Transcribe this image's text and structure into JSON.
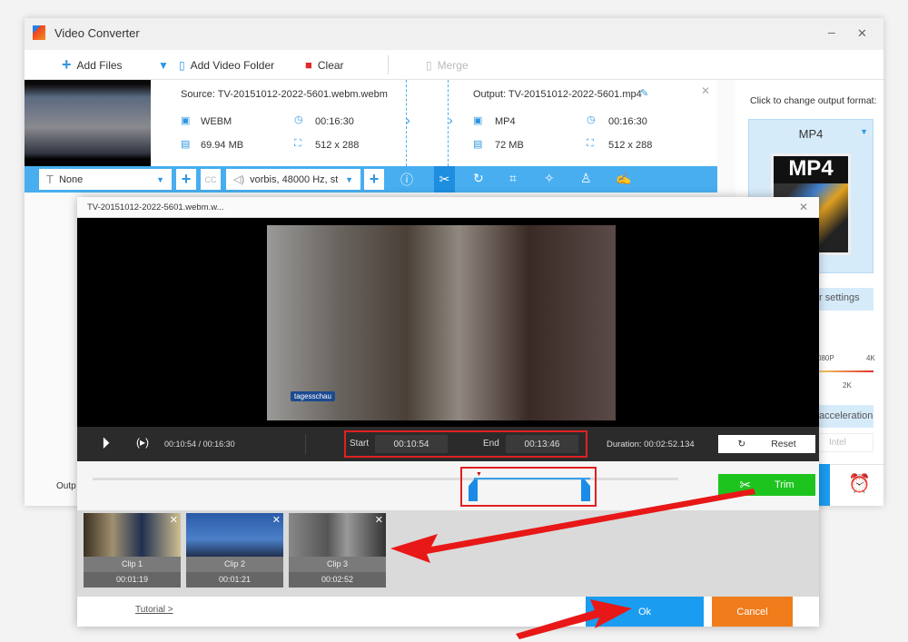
{
  "app": {
    "title": "Video Converter",
    "minimize": "–",
    "close": "✕"
  },
  "toolbar": {
    "add_files": "Add Files",
    "add_folder": "Add Video Folder",
    "clear": "Clear",
    "merge": "Merge"
  },
  "file": {
    "source": "Source: TV-20151012-2022-5601.webm.webm",
    "src_format": "WEBM",
    "src_duration": "00:16:30",
    "src_size": "69.94 MB",
    "src_res": "512 x 288",
    "output": "Output: TV-20151012-2022-5601.mp4",
    "out_format": "MP4",
    "out_duration": "00:16:30",
    "out_size": "72 MB",
    "out_res": "512 x 288"
  },
  "edit_bar": {
    "subtitle": "None",
    "audio": "vorbis, 48000 Hz, st"
  },
  "right_panel": {
    "hint": "Click to change output format:",
    "format": "MP4",
    "format_icon": "MP4",
    "settings": "r settings",
    "q1080": "080P",
    "q4k": "4K",
    "q2k": "2K",
    "accel": "acceleration",
    "intel": "Intel"
  },
  "bottom": {
    "output_label": "Outp"
  },
  "dialog": {
    "title": "TV-20151012-2022-5601.webm.w...",
    "current": "00:10:54",
    "total": "00:16:30",
    "sep": "/",
    "start_label": "Start",
    "start": "00:10:54",
    "end_label": "End",
    "end": "00:13:46",
    "duration": "Duration:  00:02:52.134",
    "reset": "Reset",
    "trim": "Trim",
    "watermark": "tagesschau",
    "clips": [
      {
        "name": "Clip 1",
        "time": "00:01:19"
      },
      {
        "name": "Clip 2",
        "time": "00:01:21"
      },
      {
        "name": "Clip 3",
        "time": "00:02:52"
      }
    ],
    "tutorial": "Tutorial >",
    "ok": "Ok",
    "cancel": "Cancel"
  },
  "colors": {
    "accent": "#48aef0",
    "ok": "#1a9cf0",
    "cancel": "#f07c1c",
    "trim": "#1ec41e",
    "highlight": "#e02020"
  }
}
